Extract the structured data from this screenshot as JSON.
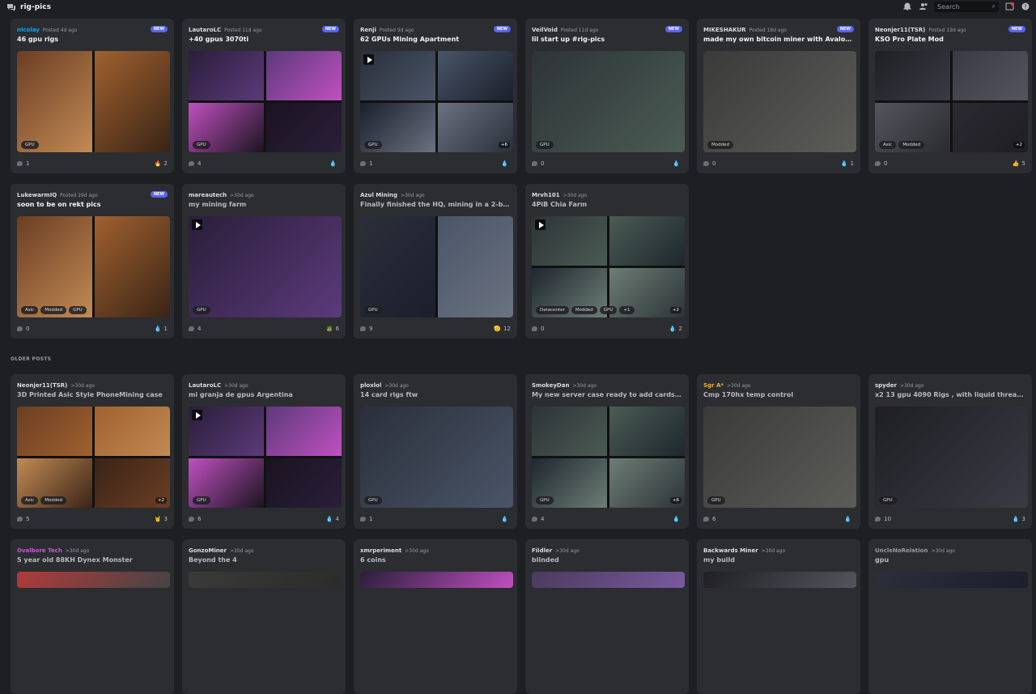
{
  "header": {
    "channel": "rig-pics",
    "search_placeholder": "Search"
  },
  "section_older": "OLDER POSTS",
  "row1": [
    {
      "author": "nicolay",
      "author_color": "#00a8fc",
      "meta": "Posted 4d ago",
      "new": "NEW",
      "title": "46 gpu rigs",
      "tags": [
        "GPU"
      ],
      "comments": "1",
      "reaction": "2",
      "emoji": "🔥",
      "layout": "half",
      "more": ""
    },
    {
      "author": "LautaroLC",
      "meta": "Posted 11d ago",
      "new": "NEW",
      "title": "+40 gpus 3070ti",
      "tags": [
        "GPU"
      ],
      "comments": "4",
      "reaction": "",
      "emoji": "💧",
      "layout": "quad",
      "more": ""
    },
    {
      "author": "Renji",
      "meta": "Posted 9d ago",
      "new": "NEW",
      "title": "62 GPUs Mining Apartment",
      "tags": [
        "GPU"
      ],
      "comments": "1",
      "reaction": "",
      "emoji": "💧",
      "layout": "quad",
      "more": "+6",
      "play": true
    },
    {
      "author": "VeilVoid",
      "meta": "Posted 11d ago",
      "new": "NEW",
      "title": "lil start up #rig-pics",
      "tags": [
        "GPU"
      ],
      "comments": "0",
      "reaction": "",
      "emoji": "💧",
      "layout": "single",
      "more": ""
    },
    {
      "author": "MIKESHAKUR",
      "meta": "Posted 18d ago",
      "new": "NEW",
      "title": "made my own bitcoin miner with Avalon min...",
      "tags": [
        "Modded"
      ],
      "comments": "0",
      "reaction": "1",
      "emoji": "💧",
      "layout": "single",
      "more": ""
    },
    {
      "author": "Neonjer11(TSR)",
      "meta": "Posted 19d ago",
      "new": "NEW",
      "title": "KSO Pro Plate Mod",
      "tags": [
        "Asic",
        "Modded"
      ],
      "comments": "0",
      "reaction": "5",
      "emoji": "👍",
      "layout": "quad",
      "more": "+2"
    }
  ],
  "row2": [
    {
      "author": "LukewarmIQ",
      "meta": "Posted 29d ago",
      "new": "NEW",
      "title": "soon to be on rekt pics",
      "tags": [
        "Asic",
        "Modded",
        "GPU"
      ],
      "comments": "0",
      "reaction": "1",
      "emoji": "💧",
      "layout": "half",
      "more": ""
    },
    {
      "author": "mareautech",
      "meta": ">30d ago",
      "new": "",
      "title": "my mining farm",
      "dim": true,
      "tags": [
        "GPU"
      ],
      "comments": "4",
      "reaction": "6",
      "emoji": "🪴",
      "layout": "single",
      "more": "",
      "play": true
    },
    {
      "author": "Azul Mining",
      "meta": ">30d ago",
      "new": "",
      "title": "Finally finished the HQ, mining in a 2-bed ap...",
      "dim": true,
      "tags": [
        "GPU"
      ],
      "comments": "9",
      "reaction": "12",
      "emoji": "🫡",
      "layout": "half",
      "more": ""
    },
    {
      "author": "Mrvh101",
      "meta": ">30d ago",
      "new": "",
      "title": "4PiB Chia Farm",
      "dim": true,
      "tags": [
        "Datacenter",
        "Modded",
        "GPU",
        "+1"
      ],
      "comments": "0",
      "reaction": "2",
      "emoji": "💧",
      "layout": "quad",
      "more": "+2",
      "play": true
    }
  ],
  "row3": [
    {
      "author": "Neonjer11(TSR)",
      "meta": ">30d ago",
      "new": "",
      "title": "3D Printed Asic Style PhoneMining case",
      "dim": true,
      "tags": [
        "Asic",
        "Modded"
      ],
      "comments": "5",
      "reaction": "3",
      "emoji": "🤘",
      "layout": "quad",
      "more": "+2"
    },
    {
      "author": "LautaroLC",
      "meta": ">30d ago",
      "new": "",
      "title": "mi granja de gpus Argentina",
      "dim": true,
      "tags": [
        "GPU"
      ],
      "comments": "6",
      "reaction": "4",
      "emoji": "💧",
      "layout": "quad",
      "more": "",
      "play": true
    },
    {
      "author": "ploxlol",
      "meta": ">30d ago",
      "new": "",
      "title": "14 card rigs ftw",
      "dim": true,
      "tags": [
        "GPU"
      ],
      "comments": "1",
      "reaction": "",
      "emoji": "💧",
      "layout": "single",
      "more": ""
    },
    {
      "author": "SmokeyDan",
      "meta": ">30d ago",
      "new": "",
      "title": "My new server case ready to add cards and ...",
      "dim": true,
      "tags": [
        "GPU"
      ],
      "comments": "4",
      "reaction": "",
      "emoji": "💧",
      "layout": "quad",
      "more": "+6"
    },
    {
      "author": "Sgr A*",
      "author_color": "#f0b232",
      "meta": ">30d ago",
      "new": "",
      "title": "Cmp 170hx temp control",
      "dim": true,
      "tags": [
        "GPU"
      ],
      "comments": "6",
      "reaction": "",
      "emoji": "💧",
      "layout": "single",
      "more": ""
    },
    {
      "author": "spyder",
      "meta": ">30d ago",
      "new": "",
      "title": "x2 13 gpu 4090 Rigs , with liquid thread ripp...",
      "dim": true,
      "tags": [
        "GPU"
      ],
      "comments": "10",
      "reaction": "3",
      "emoji": "💧",
      "layout": "single",
      "more": ""
    }
  ],
  "row4": [
    {
      "author": "Ovalbore Tech",
      "author_color": "#c65bd6",
      "meta": ">30d ago",
      "title": "5 year old 88KH Dynex Monster",
      "dim": true
    },
    {
      "author": "GonzoMiner",
      "meta": ">30d ago",
      "title": "Beyond the 4",
      "dim": true
    },
    {
      "author": "xmrperiment",
      "meta": ">30d ago",
      "title": "6 coins",
      "dim": true
    },
    {
      "author": "Fiidler",
      "meta": ">30d ago",
      "title": "blinded",
      "dim": true
    },
    {
      "author": "Backwards Miner",
      "meta": ">30d ago",
      "title": "my build",
      "dim": true
    },
    {
      "author": "UncleNoRelation",
      "author_color": "#949ba4",
      "meta": ">30d ago",
      "title": "gpu",
      "dim": true
    }
  ],
  "colors": {
    "accent": "#5865f2",
    "card": "#2b2d31",
    "bg": "#1e1f22"
  }
}
